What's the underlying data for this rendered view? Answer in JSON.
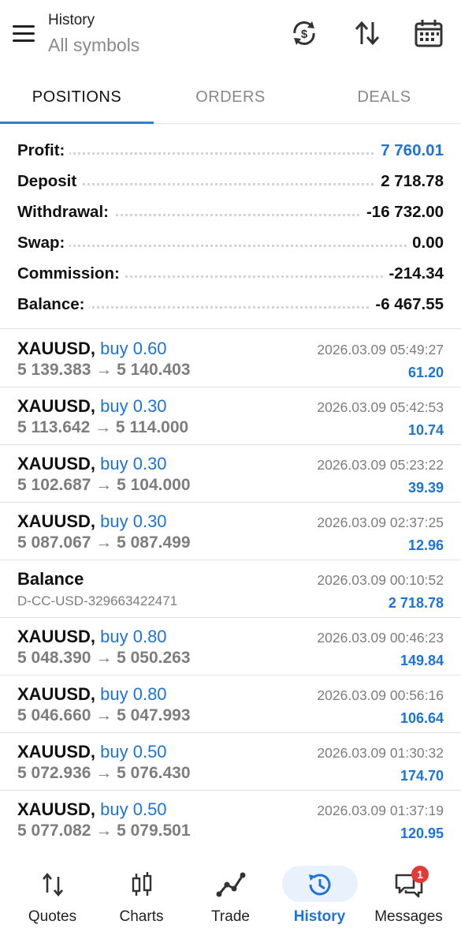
{
  "header": {
    "title": "History",
    "subtitle": "All symbols"
  },
  "tabs": [
    {
      "label": "POSITIONS",
      "active": true
    },
    {
      "label": "ORDERS",
      "active": false
    },
    {
      "label": "DEALS",
      "active": false
    }
  ],
  "summary": {
    "profit": {
      "label": "Profit:",
      "value": "7 760.01"
    },
    "deposit": {
      "label": "Deposit",
      "value": "2 718.78"
    },
    "withdrawal": {
      "label": "Withdrawal:",
      "value": "-16 732.00"
    },
    "swap": {
      "label": "Swap:",
      "value": "0.00"
    },
    "commission": {
      "label": "Commission:",
      "value": "-214.34"
    },
    "balance": {
      "label": "Balance:",
      "value": "-6 467.55"
    }
  },
  "items": [
    {
      "symbol": "XAUUSD,",
      "side": "buy 0.60",
      "prices": "5 139.383 → 5 140.403",
      "time": "2026.03.09 05:49:27",
      "profit": "61.20"
    },
    {
      "symbol": "XAUUSD,",
      "side": "buy 0.30",
      "prices": "5 113.642 → 5 114.000",
      "time": "2026.03.09 05:42:53",
      "profit": "10.74"
    },
    {
      "symbol": "XAUUSD,",
      "side": "buy 0.30",
      "prices": "5 102.687 → 5 104.000",
      "time": "2026.03.09 05:23:22",
      "profit": "39.39"
    },
    {
      "symbol": "XAUUSD,",
      "side": "buy 0.30",
      "prices": "5 087.067 → 5 087.499",
      "time": "2026.03.09 02:37:25",
      "profit": "12.96"
    },
    {
      "symbol": "Balance",
      "side": "",
      "sub": "D-CC-USD-329663422471",
      "time": "2026.03.09 00:10:52",
      "profit": "2 718.78"
    },
    {
      "symbol": "XAUUSD,",
      "side": "buy 0.80",
      "prices": "5 048.390 → 5 050.263",
      "time": "2026.03.09 00:46:23",
      "profit": "149.84"
    },
    {
      "symbol": "XAUUSD,",
      "side": "buy 0.80",
      "prices": "5 046.660 → 5 047.993",
      "time": "2026.03.09 00:56:16",
      "profit": "106.64"
    },
    {
      "symbol": "XAUUSD,",
      "side": "buy 0.50",
      "prices": "5 072.936 → 5 076.430",
      "time": "2026.03.09 01:30:32",
      "profit": "174.70"
    },
    {
      "symbol": "XAUUSD,",
      "side": "buy 0.50",
      "prices": "5 077.082 → 5 079.501",
      "time": "2026.03.09 01:37:19",
      "profit": "120.95"
    }
  ],
  "nav": [
    {
      "label": "Quotes",
      "icon": "quotes-arrows-icon"
    },
    {
      "label": "Charts",
      "icon": "candlestick-icon"
    },
    {
      "label": "Trade",
      "icon": "trade-line-icon"
    },
    {
      "label": "History",
      "icon": "history-clock-icon",
      "active": true
    },
    {
      "label": "Messages",
      "icon": "messages-icon",
      "badge": "1"
    }
  ],
  "colors": {
    "accent": "#1e73d6",
    "badge": "#e53935",
    "active_pill": "#e9f2fc"
  }
}
